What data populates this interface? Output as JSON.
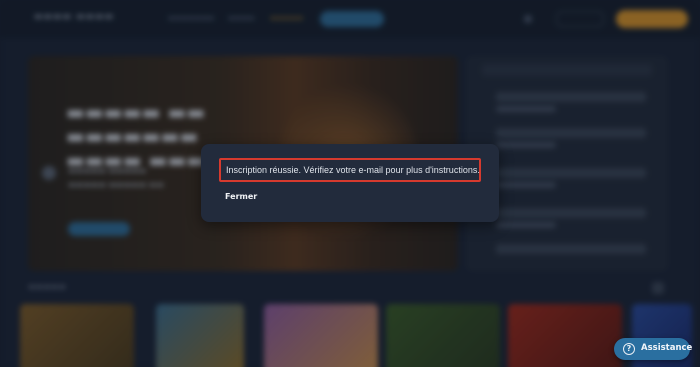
{
  "modal": {
    "message": "Inscription réussie. Vérifiez votre e-mail pour plus d'instructions.",
    "close_label": "Fermer",
    "highlight_color": "#d63a2e"
  },
  "assistance": {
    "label": "Assistance",
    "icon": "question-icon",
    "icon_glyph": "?"
  },
  "colors": {
    "accent_blue": "#2a6fa0",
    "accent_orange": "#d0902c"
  }
}
